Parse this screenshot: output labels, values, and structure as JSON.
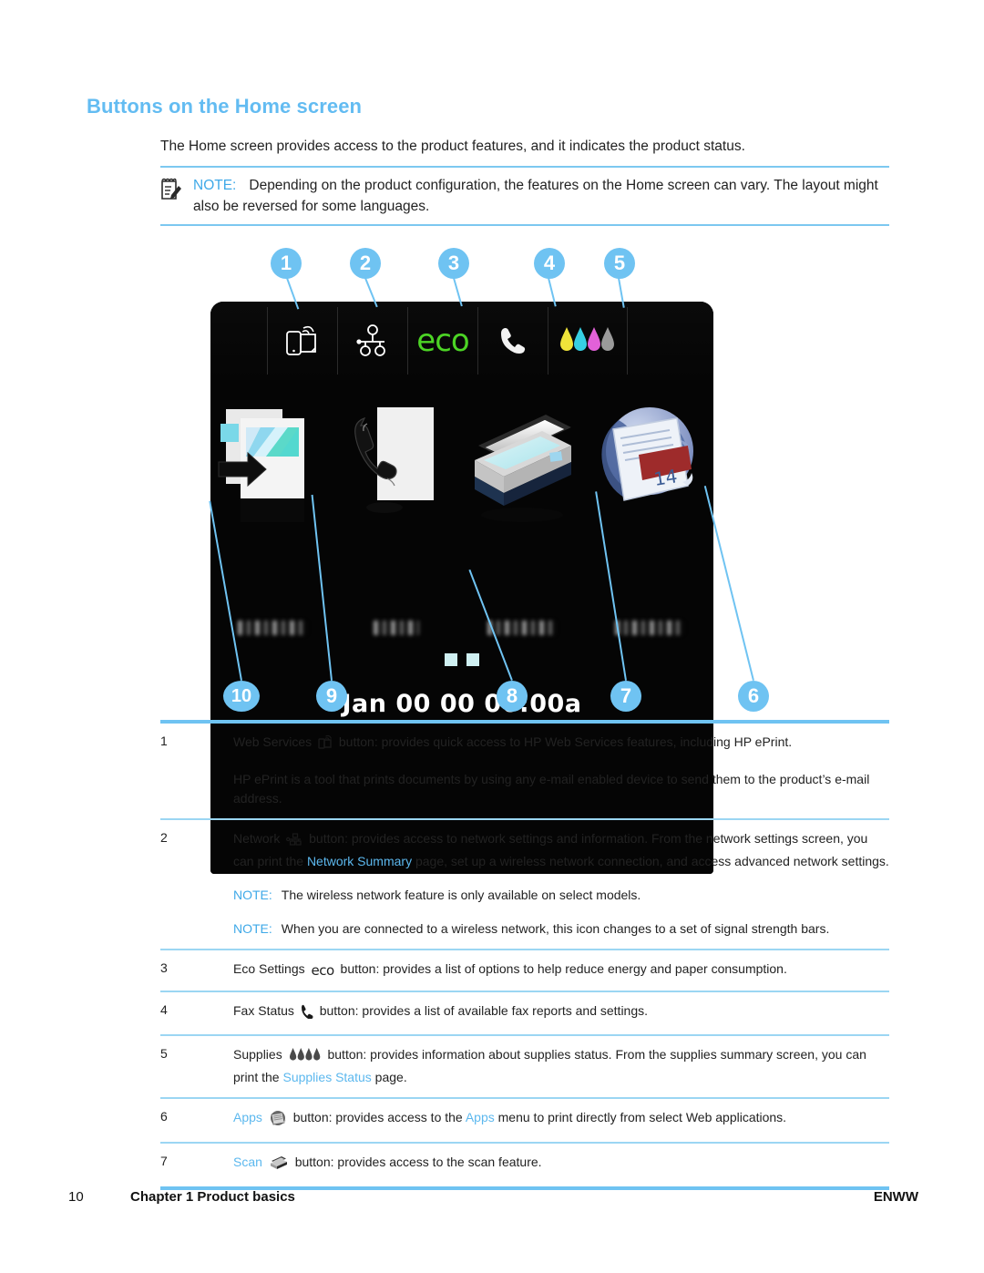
{
  "heading": "Buttons on the Home screen",
  "intro": "The Home screen provides access to the product features, and it indicates the product status.",
  "note": {
    "label": "NOTE:",
    "text": "Depending on the product configuration, the features on the Home screen can vary. The layout might also be reversed for some languages.",
    "icon": "notepad-pencil-icon"
  },
  "figure": {
    "callouts_top": [
      {
        "num": "1",
        "target": "web-services-icon"
      },
      {
        "num": "2",
        "target": "network-icon"
      },
      {
        "num": "3",
        "target": "eco-settings-icon"
      },
      {
        "num": "4",
        "target": "fax-status-icon"
      },
      {
        "num": "5",
        "target": "supplies-icon"
      }
    ],
    "callouts_bottom": [
      {
        "num": "10",
        "target": "copy-app"
      },
      {
        "num": "9",
        "target": "fax-app"
      },
      {
        "num": "8",
        "target": "date-time"
      },
      {
        "num": "7",
        "target": "scan-app"
      },
      {
        "num": "6",
        "target": "apps-app"
      }
    ],
    "toolbar": {
      "eco_label": "eco",
      "icons": [
        "web-services-icon",
        "network-icon",
        "eco-settings-icon",
        "fax-status-icon",
        "supplies-icon"
      ]
    },
    "apps": [
      {
        "name": "copy-app-icon",
        "label_visible": false
      },
      {
        "name": "fax-app-icon",
        "label_visible": false
      },
      {
        "name": "scan-app-icon",
        "label_visible": false
      },
      {
        "name": "apps-app-icon",
        "label_visible": false,
        "badge": "14"
      }
    ],
    "page_dots": 2,
    "clock": "Jan 00 00 00:00a"
  },
  "table": {
    "rows": [
      {
        "num": "1",
        "icon": "web-services-icon",
        "lead": "Web Services",
        "tail": " button: provides quick access to HP Web Services features, including HP ePrint.",
        "extra": "HP ePrint is a tool that prints documents by using any e-mail enabled device to send them to the product’s e-mail address."
      },
      {
        "num": "2",
        "icon": "network-icon",
        "lead": "Network",
        "tail_a": " button: provides access to network settings and information. From the network settings screen, you can print the ",
        "xref": "Network Summary",
        "tail_b": " page, set up a wireless network connection, and access advanced network settings.",
        "note1_label": "NOTE:",
        "note1": "The wireless network feature is only available on select models.",
        "note2_label": "NOTE:",
        "note2": "When you are connected to a wireless network, this icon changes to a set of signal strength bars."
      },
      {
        "num": "3",
        "icon": "eco-settings-icon",
        "lead": "Eco Settings",
        "icon_text": "eco",
        "tail": " button: provides a list of options to help reduce energy and paper consumption."
      },
      {
        "num": "4",
        "icon": "fax-status-icon",
        "lead": "Fax Status",
        "tail": " button: provides a list of available fax reports and settings."
      },
      {
        "num": "5",
        "icon": "supplies-icon",
        "lead": "Supplies",
        "tail_a": " button: provides information about supplies status. From the supplies summary screen, you can print the ",
        "xref": "Supplies Status",
        "tail_b": " page."
      },
      {
        "num": "6",
        "icon": "apps-globe-icon",
        "lead_xref": "Apps",
        "tail_a": " button: provides access to the ",
        "xref": "Apps",
        "tail_b": " menu to print directly from select Web applications."
      },
      {
        "num": "7",
        "icon": "scanner-icon",
        "lead_xref": "Scan",
        "tail": " button: provides access to the scan feature."
      }
    ]
  },
  "footer": {
    "page_number": "10",
    "chapter": "Chapter 1   Product basics",
    "locale": "ENWW"
  },
  "colors": {
    "accent_blue": "#6FC3F2",
    "heading_blue": "#63BCF2",
    "xref_blue": "#5CB8EE",
    "eco_green": "#4CD425",
    "ink_yellow": "#EFE43A",
    "ink_cyan": "#36CFE3",
    "ink_magenta": "#E261D8",
    "ink_gray": "#9A9A9A"
  }
}
